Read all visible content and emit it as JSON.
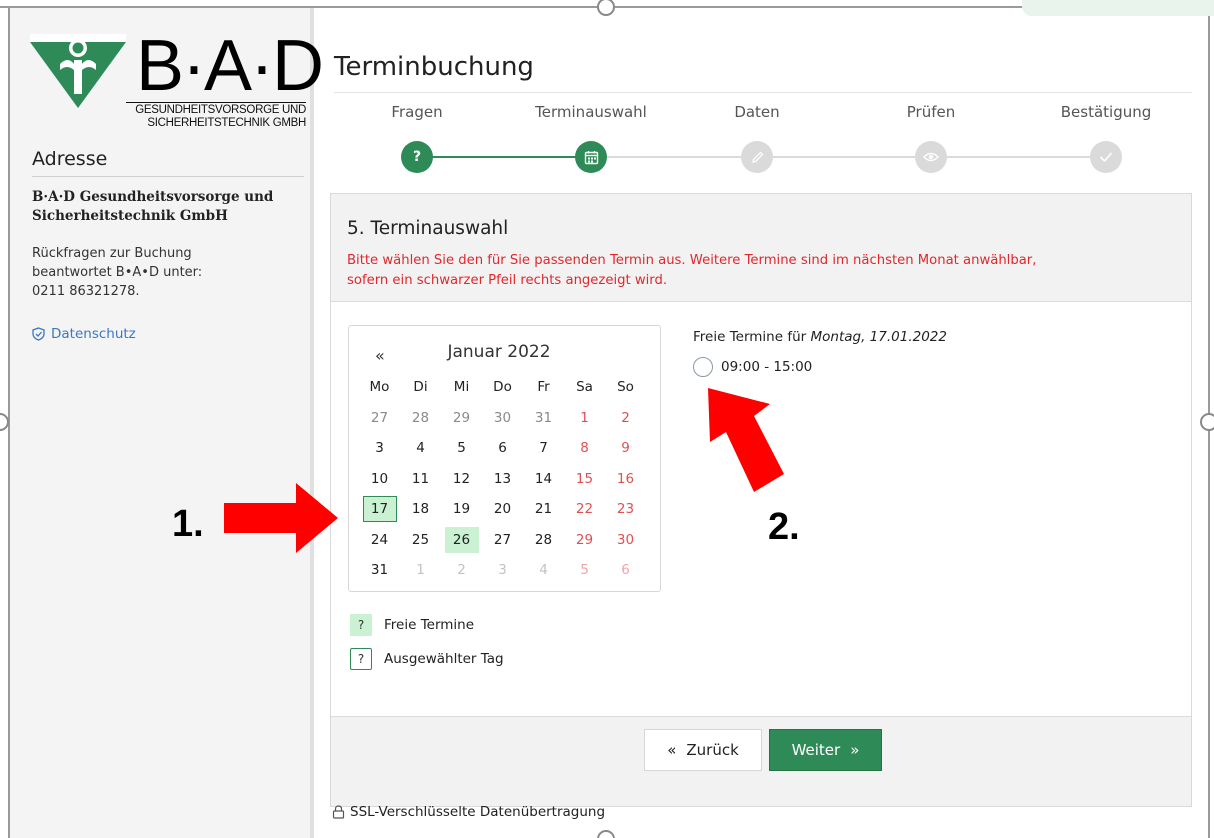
{
  "brand": {
    "name": "B·A·D",
    "subtitle_line1": "GESUNDHEITSVORSORGE UND",
    "subtitle_line2": "SICHERHEITSTECHNIK GMBH"
  },
  "sidebar": {
    "heading": "Adresse",
    "company_line1": "B·A·D Gesundheitsvorsorge und",
    "company_line2": "Sicherheitstechnik GmbH",
    "contact_line1": "Rückfragen zur Buchung",
    "contact_line2": "beantwortet B•A•D unter:",
    "contact_line3": "0211 86321278.",
    "privacy_link": "Datenschutz"
  },
  "page": {
    "title": "Terminbuchung"
  },
  "steps": [
    {
      "label": "Fragen",
      "icon": "question-icon",
      "active": true
    },
    {
      "label": "Terminauswahl",
      "icon": "calendar-icon",
      "active": true
    },
    {
      "label": "Daten",
      "icon": "pencil-icon",
      "active": false
    },
    {
      "label": "Prüfen",
      "icon": "eye-icon",
      "active": false
    },
    {
      "label": "Bestätigung",
      "icon": "check-icon",
      "active": false
    }
  ],
  "section": {
    "title": "5. Terminauswahl",
    "hint_line1": "Bitte wählen Sie den für Sie passenden Termin aus. Weitere Termine sind im nächsten Monat anwählbar,",
    "hint_line2": "sofern ein schwarzer Pfeil rechts angezeigt wird."
  },
  "calendar": {
    "prev_label": "«",
    "month_label": "Januar 2022",
    "weekdays": [
      "Mo",
      "Di",
      "Mi",
      "Do",
      "Fr",
      "Sa",
      "So"
    ],
    "weeks": [
      [
        "27",
        "28",
        "29",
        "30",
        "31",
        "1",
        "2"
      ],
      [
        "3",
        "4",
        "5",
        "6",
        "7",
        "8",
        "9"
      ],
      [
        "10",
        "11",
        "12",
        "13",
        "14",
        "15",
        "16"
      ],
      [
        "17",
        "18",
        "19",
        "20",
        "21",
        "22",
        "23"
      ],
      [
        "24",
        "25",
        "26",
        "27",
        "28",
        "29",
        "30"
      ],
      [
        "31",
        "1",
        "2",
        "3",
        "4",
        "5",
        "6"
      ]
    ],
    "selected_day": "17",
    "free_days": [
      "17",
      "26"
    ]
  },
  "slots": {
    "title_prefix": "Freie Termine für",
    "date_label": "Montag, 17.01.2022",
    "items": [
      "09:00 - 15:00"
    ]
  },
  "legend": {
    "free_symbol": "?",
    "free_label": "Freie Termine",
    "selected_symbol": "?",
    "selected_label": "Ausgewählter Tag"
  },
  "buttons": {
    "back_icon": "«",
    "back_label": "Zurück",
    "next_label": "Weiter",
    "next_icon": "»"
  },
  "footer": {
    "ssl_label": "SSL-Verschlüsselte Datenübertragung"
  },
  "annotations": {
    "marker1": "1.",
    "marker2": "2."
  },
  "colors": {
    "accent_green": "#2e8b57",
    "free_day_bg": "#c9f1d2",
    "warning_red": "#e0282d",
    "arrow_red": "#ff0000",
    "link_blue": "#3a78c3"
  }
}
